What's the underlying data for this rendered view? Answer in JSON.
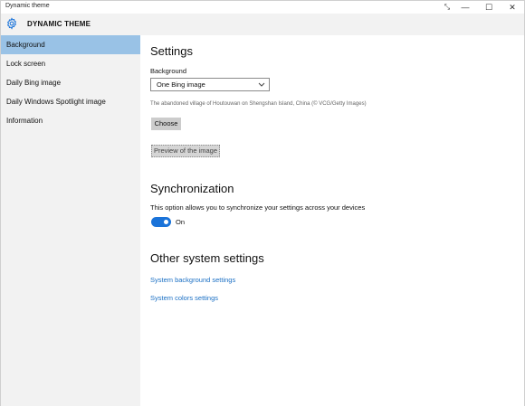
{
  "window": {
    "title": "Dynamic theme",
    "controls": {
      "extra": "⤡",
      "minimize": "—",
      "maximize": "☐",
      "close": "✕"
    }
  },
  "header": {
    "app_title": "DYNAMIC THEME",
    "icon": "gear-icon",
    "accent": "#1a73d9"
  },
  "sidebar": {
    "items": [
      {
        "label": "Background",
        "active": true
      },
      {
        "label": "Lock screen",
        "active": false
      },
      {
        "label": "Daily Bing image",
        "active": false
      },
      {
        "label": "Daily Windows Spotlight image",
        "active": false
      },
      {
        "label": "Information",
        "active": false
      }
    ]
  },
  "main": {
    "settings": {
      "heading": "Settings",
      "background_label": "Background",
      "background_value": "One Bing image",
      "caption": "The abandoned village of Houtouwan on Shengshan Island, China (© VCG/Getty Images)",
      "choose_label": "Choose",
      "preview_label": "Preview of the image"
    },
    "sync": {
      "heading": "Synchronization",
      "description": "This option allows you to synchronize your settings across your devices",
      "toggle_label": "On",
      "toggle_on": true
    },
    "other": {
      "heading": "Other system settings",
      "link1": "System background settings",
      "link2": "System colors settings"
    }
  }
}
